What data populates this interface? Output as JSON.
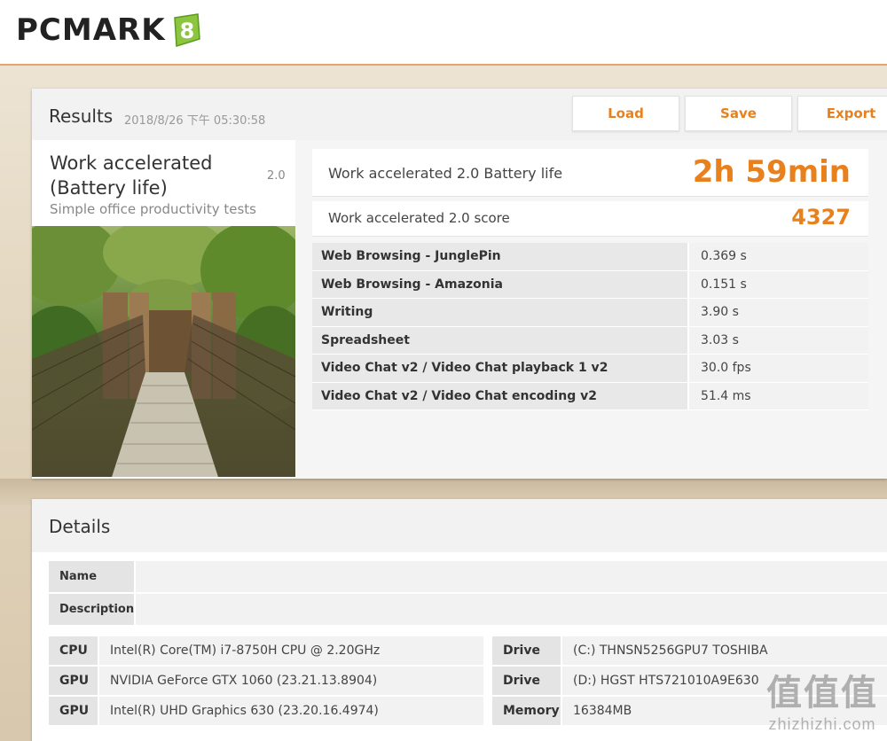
{
  "app": {
    "logo_text": "PCMARK",
    "logo_badge": "8",
    "accent_color": "#e8801e"
  },
  "results": {
    "title": "Results",
    "date": "2018/8/26 下午 05:30:58",
    "buttons": {
      "load": "Load",
      "save": "Save",
      "export": "Export"
    },
    "test": {
      "title": "Work accelerated (Battery life)",
      "version": "2.0",
      "subtitle": "Simple office productivity tests",
      "image_icon": "suspension-bridge-image"
    },
    "battery_life": {
      "label": "Work accelerated 2.0 Battery life",
      "value": "2h 59min"
    },
    "score": {
      "label": "Work accelerated 2.0 score",
      "value": "4327"
    },
    "subtests": [
      {
        "name": "Web Browsing - JunglePin",
        "value": "0.369 s"
      },
      {
        "name": "Web Browsing - Amazonia",
        "value": "0.151 s"
      },
      {
        "name": "Writing",
        "value": "3.90 s"
      },
      {
        "name": "Spreadsheet",
        "value": "3.03 s"
      },
      {
        "name": "Video Chat v2 / Video Chat playback 1 v2",
        "value": "30.0 fps"
      },
      {
        "name": "Video Chat v2 / Video Chat encoding v2",
        "value": "51.4 ms"
      }
    ]
  },
  "details": {
    "title": "Details",
    "name_label": "Name",
    "name_value": "",
    "description_label": "Description",
    "description_value": "",
    "specs": [
      {
        "label": "CPU",
        "value": "Intel(R) Core(TM) i7-8750H CPU @ 2.20GHz",
        "label2": "Drive",
        "value2": "(C:) THNSN5256GPU7 TOSHIBA"
      },
      {
        "label": "GPU",
        "value": "NVIDIA GeForce GTX 1060 (23.21.13.8904)",
        "label2": "Drive",
        "value2": "(D:) HGST HTS721010A9E630"
      },
      {
        "label": "GPU",
        "value": "Intel(R) UHD Graphics 630 (23.20.16.4974)",
        "label2": "Memory",
        "value2": "16384MB"
      }
    ]
  },
  "watermark": {
    "glyphs": "值值值",
    "text": "zhizhizhi.com"
  }
}
